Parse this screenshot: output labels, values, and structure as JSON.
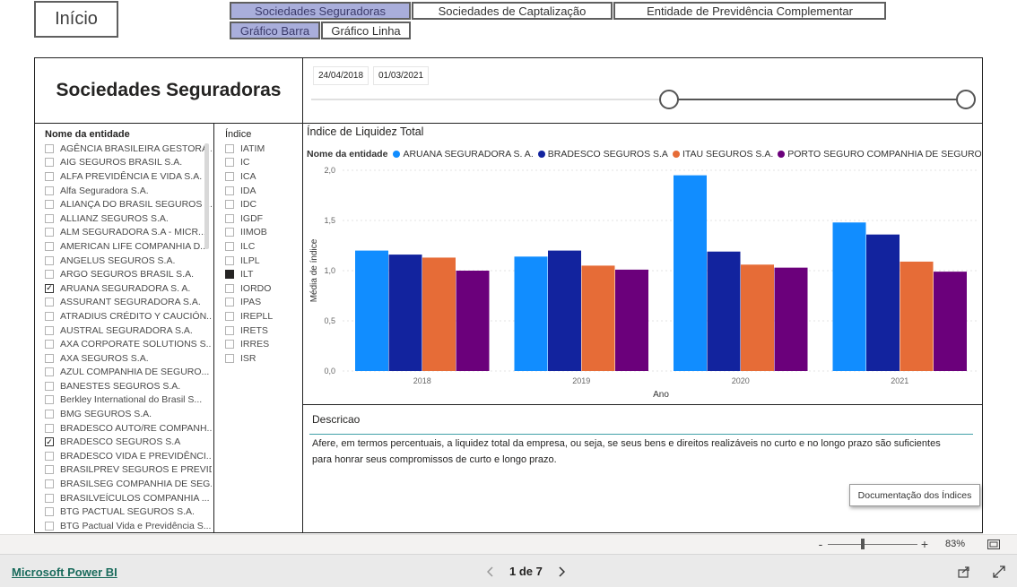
{
  "header": {
    "home_label": "Início",
    "tabs": [
      {
        "label": "Sociedades Seguradoras",
        "active": true
      },
      {
        "label": "Sociedades de Captalização",
        "active": false
      },
      {
        "label": "Entidade de Previdência Complementar",
        "active": false
      }
    ],
    "chart_toggles": [
      {
        "label": "Gráfico Barra",
        "active": true
      },
      {
        "label": "Gráfico Linha",
        "active": false
      }
    ]
  },
  "page_title": "Sociedades Seguradoras",
  "date_range": {
    "start": "24/04/2018",
    "end": "01/03/2021"
  },
  "entity_slicer": {
    "title": "Nome da entidade",
    "items": [
      {
        "label": "AGÊNCIA BRASILEIRA GESTORA ...",
        "checked": false
      },
      {
        "label": "AIG SEGUROS BRASIL S.A.",
        "checked": false
      },
      {
        "label": "ALFA PREVIDÊNCIA E VIDA S.A.",
        "checked": false
      },
      {
        "label": "Alfa Seguradora S.A.",
        "checked": false
      },
      {
        "label": "ALIANÇA DO BRASIL SEGUROS ...",
        "checked": false
      },
      {
        "label": "ALLIANZ SEGUROS S.A.",
        "checked": false
      },
      {
        "label": "ALM SEGURADORA S.A - MICR...",
        "checked": false
      },
      {
        "label": "AMERICAN LIFE COMPANHIA D...",
        "checked": false
      },
      {
        "label": "ANGELUS SEGUROS S.A.",
        "checked": false
      },
      {
        "label": "ARGO SEGUROS BRASIL S.A.",
        "checked": false
      },
      {
        "label": "ARUANA SEGURADORA S. A.",
        "checked": true
      },
      {
        "label": "ASSURANT SEGURADORA S.A.",
        "checked": false
      },
      {
        "label": "ATRADIUS CRÉDITO Y CAUCIÓN...",
        "checked": false
      },
      {
        "label": "AUSTRAL SEGURADORA S.A.",
        "checked": false
      },
      {
        "label": "AXA CORPORATE SOLUTIONS S...",
        "checked": false
      },
      {
        "label": "AXA SEGUROS S.A.",
        "checked": false
      },
      {
        "label": "AZUL COMPANHIA DE SEGURO...",
        "checked": false
      },
      {
        "label": "BANESTES SEGUROS S.A.",
        "checked": false
      },
      {
        "label": "Berkley International do Brasil S...",
        "checked": false
      },
      {
        "label": "BMG SEGUROS S.A.",
        "checked": false
      },
      {
        "label": "BRADESCO AUTO/RE COMPANH...",
        "checked": false
      },
      {
        "label": "BRADESCO SEGUROS S.A",
        "checked": true
      },
      {
        "label": "BRADESCO VIDA E PREVIDÊNCI...",
        "checked": false
      },
      {
        "label": "BRASILPREV SEGUROS E PREVID...",
        "checked": false
      },
      {
        "label": "BRASILSEG COMPANHIA DE SEG...",
        "checked": false
      },
      {
        "label": "BRASILVEÍCULOS COMPANHIA ...",
        "checked": false
      },
      {
        "label": "BTG PACTUAL SEGUROS S.A.",
        "checked": false
      },
      {
        "label": "BTG Pactual Vida e Previdência S...",
        "checked": false
      }
    ]
  },
  "index_slicer": {
    "title": "Índice",
    "items": [
      {
        "label": "IATIM",
        "checked": false
      },
      {
        "label": "IC",
        "checked": false
      },
      {
        "label": "ICA",
        "checked": false
      },
      {
        "label": "IDA",
        "checked": false
      },
      {
        "label": "IDC",
        "checked": false
      },
      {
        "label": "IGDF",
        "checked": false
      },
      {
        "label": "IIMOB",
        "checked": false
      },
      {
        "label": "ILC",
        "checked": false
      },
      {
        "label": "ILPL",
        "checked": false
      },
      {
        "label": "ILT",
        "checked": true
      },
      {
        "label": "IORDO",
        "checked": false
      },
      {
        "label": "IPAS",
        "checked": false
      },
      {
        "label": "IREPLL",
        "checked": false
      },
      {
        "label": "IRETS",
        "checked": false
      },
      {
        "label": "IRRES",
        "checked": false
      },
      {
        "label": "ISR",
        "checked": false
      }
    ]
  },
  "chart_data": {
    "type": "bar",
    "title": "Índice de Liquidez Total",
    "legend_title": "Nome da entidade",
    "legend_placement": "top-left",
    "xlabel": "Ano",
    "ylabel": "Média de índice",
    "ylim": [
      0,
      2.0
    ],
    "yticks": [
      "0,0",
      "0,5",
      "1,0",
      "1,5",
      "2,0"
    ],
    "grid": true,
    "categories": [
      "2018",
      "2019",
      "2020",
      "2021"
    ],
    "series": [
      {
        "name": "ARUANA SEGURADORA S. A.",
        "color": "#118DFF",
        "values": [
          1.2,
          1.14,
          1.95,
          1.48
        ]
      },
      {
        "name": "BRADESCO SEGUROS S.A",
        "color": "#12239E",
        "values": [
          1.16,
          1.2,
          1.19,
          1.36
        ]
      },
      {
        "name": "ITAU SEGUROS S.A.",
        "color": "#E66C37",
        "values": [
          1.13,
          1.05,
          1.06,
          1.09
        ]
      },
      {
        "name": "PORTO SEGURO COMPANHIA DE SEGUROS GE...",
        "color": "#6B007B",
        "values": [
          1.0,
          1.01,
          1.03,
          0.99
        ]
      }
    ]
  },
  "description": {
    "title": "Descricao",
    "text": "Afere, em termos percentuais, a liquidez total da empresa, ou seja, se seus bens e direitos realizáveis no curto e no longo prazo são suficientes para honrar seus compromissos de curto e longo prazo.",
    "doc_button": "Documentação dos Índices"
  },
  "zoom": {
    "minus": "-",
    "plus": "+",
    "level": "83%",
    "fraction": 0.83
  },
  "footer": {
    "brand": "Microsoft Power BI",
    "page_indicator": "1 de 7",
    "prev_icon": "chevron-left-icon",
    "next_icon": "chevron-right-icon",
    "share_icon": "share-icon",
    "fullscreen_icon": "expand-icon"
  }
}
